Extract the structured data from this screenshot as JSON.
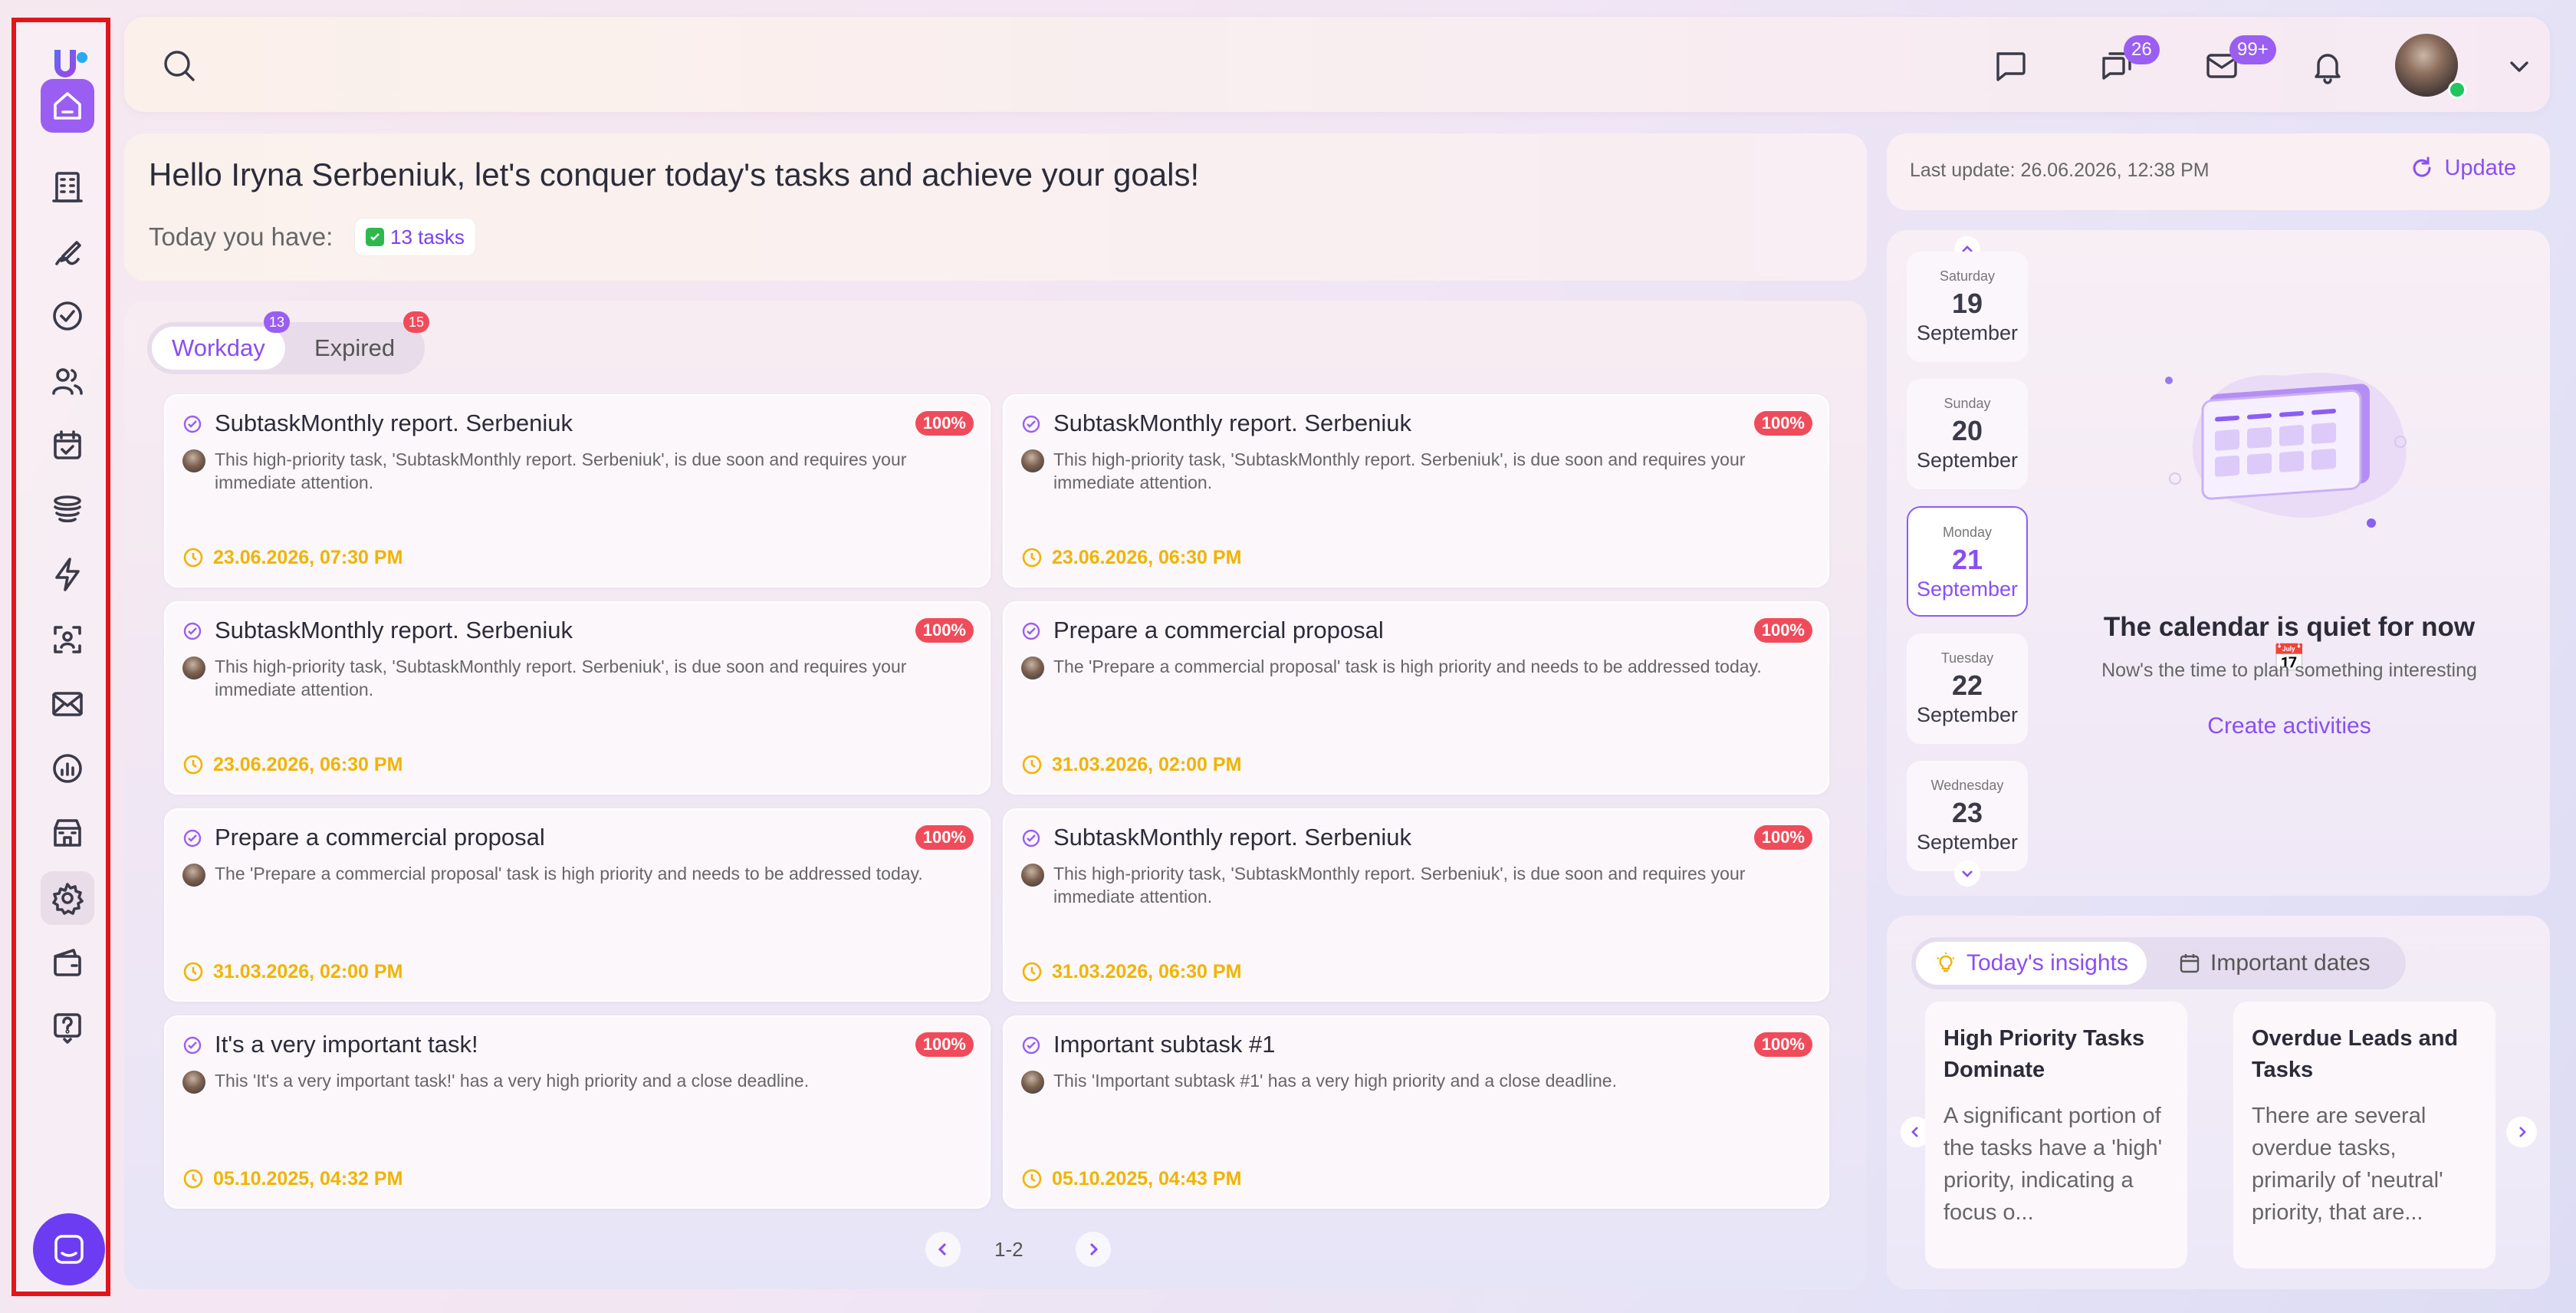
{
  "colors": {
    "accent": "#9a5ff2",
    "danger": "#ef4b5a",
    "deadline": "#f0b400",
    "online": "#22c55e"
  },
  "sidebar": {
    "items": [
      {
        "name": "home",
        "icon": "home-icon",
        "active": true
      },
      {
        "name": "companies",
        "icon": "building-icon"
      },
      {
        "name": "signatures",
        "icon": "sign-icon"
      },
      {
        "name": "tasks",
        "icon": "check-circle-icon"
      },
      {
        "name": "contacts",
        "icon": "users-icon"
      },
      {
        "name": "calendar",
        "icon": "calendar-check-icon"
      },
      {
        "name": "funnels",
        "icon": "funnel-stack-icon"
      },
      {
        "name": "automation",
        "icon": "lightning-icon"
      },
      {
        "name": "scan",
        "icon": "scan-icon"
      },
      {
        "name": "mail",
        "icon": "mail-icon"
      },
      {
        "name": "analytics",
        "icon": "chart-icon"
      },
      {
        "name": "store",
        "icon": "store-icon"
      },
      {
        "name": "settings",
        "icon": "gear-icon"
      },
      {
        "name": "wallet",
        "icon": "wallet-icon"
      },
      {
        "name": "help",
        "icon": "help-icon"
      }
    ]
  },
  "topbar": {
    "chat_badge": "26",
    "mail_badge": "99+"
  },
  "greeting": {
    "text": "Hello Iryna Serbeniuk, let's conquer today's tasks and achieve your goals!",
    "today_label": "Today you have:",
    "tasks_chip": "13 tasks"
  },
  "tasks": {
    "tabs": [
      {
        "label": "Workday",
        "count": "13"
      },
      {
        "label": "Expired",
        "count": "15"
      }
    ],
    "cards": [
      {
        "title": "SubtaskMonthly report. Serbeniuk",
        "pct": "100%",
        "desc": "This high-priority task, 'SubtaskMonthly report. Serbeniuk', is due soon and requires your immediate attention.",
        "date": "23.06.2026, 07:30 PM"
      },
      {
        "title": "SubtaskMonthly report. Serbeniuk",
        "pct": "100%",
        "desc": "This high-priority task, 'SubtaskMonthly report. Serbeniuk', is due soon and requires your immediate attention.",
        "date": "23.06.2026, 06:30 PM"
      },
      {
        "title": "SubtaskMonthly report. Serbeniuk",
        "pct": "100%",
        "desc": "This high-priority task, 'SubtaskMonthly report. Serbeniuk', is due soon and requires your immediate attention.",
        "date": "23.06.2026, 06:30 PM"
      },
      {
        "title": "Prepare a commercial proposal",
        "pct": "100%",
        "desc": "The 'Prepare a commercial proposal' task is high priority and needs to be addressed today.",
        "date": "31.03.2026, 02:00 PM"
      },
      {
        "title": "Prepare a commercial proposal",
        "pct": "100%",
        "desc": "The 'Prepare a commercial proposal' task is high priority and needs to be addressed today.",
        "date": "31.03.2026, 02:00 PM"
      },
      {
        "title": "SubtaskMonthly report. Serbeniuk",
        "pct": "100%",
        "desc": "This high-priority task, 'SubtaskMonthly report. Serbeniuk', is due soon and requires your immediate attention.",
        "date": "31.03.2026, 06:30 PM"
      },
      {
        "title": "It's a very important task!",
        "pct": "100%",
        "desc": "This 'It's a very important task!' has a very high priority and a close deadline.",
        "date": "05.10.2025, 04:32 PM"
      },
      {
        "title": "Important subtask #1",
        "pct": "100%",
        "desc": "This 'Important subtask #1' has a very high priority and a close deadline.",
        "date": "05.10.2025, 04:43 PM"
      }
    ],
    "pager": "1-2"
  },
  "update": {
    "last": "Last update: 26.06.2026, 12:38 PM",
    "button": "Update"
  },
  "calendar": {
    "days": [
      {
        "dow": "Saturday",
        "num": "19",
        "mon": "September"
      },
      {
        "dow": "Sunday",
        "num": "20",
        "mon": "September"
      },
      {
        "dow": "Monday",
        "num": "21",
        "mon": "September",
        "selected": true
      },
      {
        "dow": "Tuesday",
        "num": "22",
        "mon": "September"
      },
      {
        "dow": "Wednesday",
        "num": "23",
        "mon": "September"
      }
    ],
    "empty_title": "The calendar is quiet for now 📅",
    "empty_sub": "Now's the time to plan something interesting",
    "create_link": "Create activities"
  },
  "insights": {
    "tabs": [
      "Today's insights",
      "Important dates"
    ],
    "items": [
      {
        "title": "High Priority Tasks Dominate",
        "body": "A significant portion of the tasks have a 'high' priority, indicating a focus o..."
      },
      {
        "title": "Overdue Leads and Tasks",
        "body": "There are several overdue tasks, primarily of 'neutral' priority, that are..."
      }
    ]
  }
}
